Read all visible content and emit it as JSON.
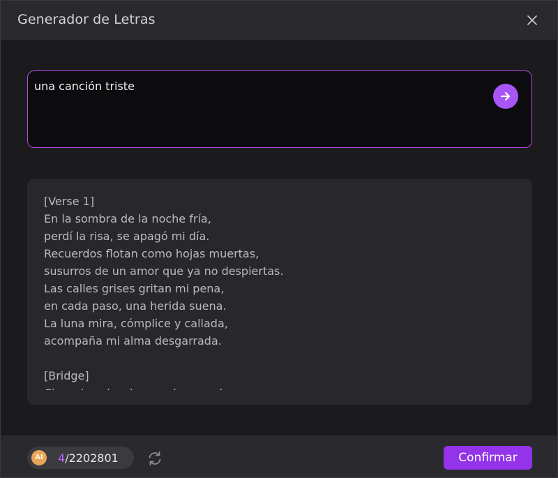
{
  "dialog": {
    "title": "Generador de Letras"
  },
  "prompt": {
    "value": "una canción triste"
  },
  "lyrics": {
    "text": "[Verse 1]\nEn la sombra de la noche fría,\nperdí la risa, se apagó mi día.\nRecuerdos flotan como hojas muertas,\nsusurros de un amor que ya no despiertas.\nLas calles grises gritan mi pena,\nen cada paso, una herida suena.\nLa luna mira, cómplice y callada,\nacompaña mi alma desgarrada.\n\n[Bridge]\nCierro los ojos, busco el consuelo"
  },
  "footer": {
    "ai_badge": "AI",
    "credits_used": "4",
    "credits_total": "/2202801",
    "confirm_label": "Confirmar"
  },
  "colors": {
    "accent": "#a855f7",
    "button": "#9333ea",
    "badge": "#e9a65a"
  },
  "icons": {
    "close": "close-icon",
    "send": "arrow-right-icon",
    "refresh": "refresh-icon"
  }
}
